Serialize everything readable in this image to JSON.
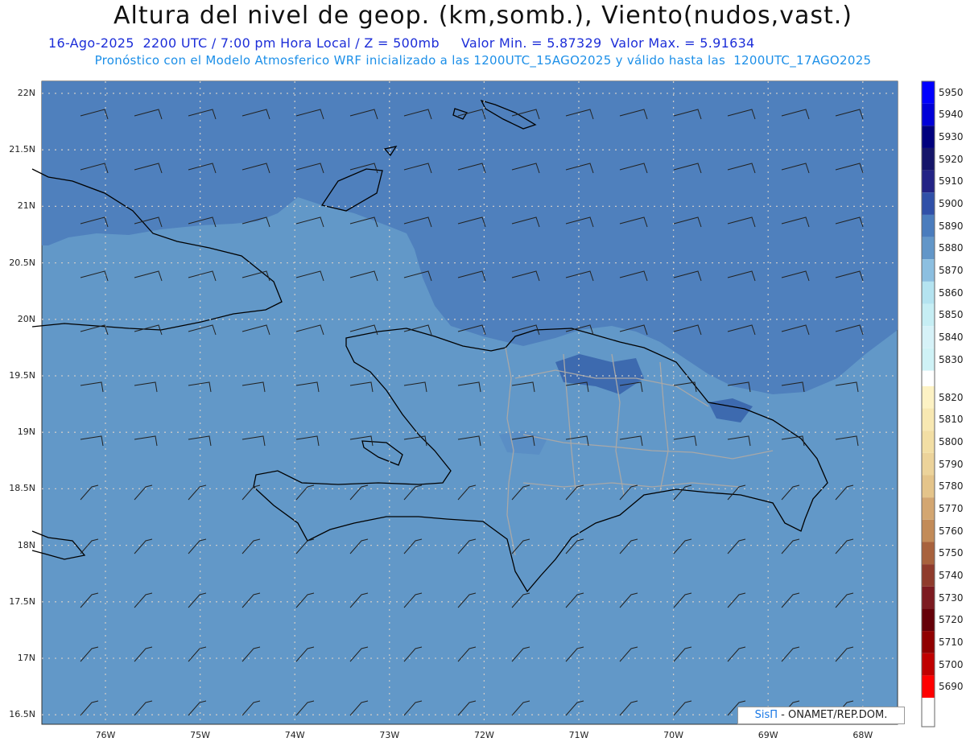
{
  "header": {
    "title": "Altura del nivel de geop. (km,somb.), Viento(nudos,vast.)",
    "subtitle1": "16-Ago-2025  2200 UTC / 7:00 pm Hora Local / Z = 500mb     Valor Min. = 5.87329  Valor Max. = 5.91634",
    "subtitle2": "Pronóstico con el Modelo Atmosferico WRF inicializado a las 1200UTC_15AGO2025 y válido hasta las  1200UTC_17AGO2025"
  },
  "axes": {
    "lat_labels": [
      "22N",
      "21.5N",
      "21N",
      "20.5N",
      "20N",
      "19.5N",
      "19N",
      "18.5N",
      "18N",
      "17.5N",
      "17N",
      "16.5N"
    ],
    "lon_labels": [
      "76W",
      "75W",
      "74W",
      "73W",
      "72W",
      "71W",
      "70W",
      "69W",
      "68W"
    ]
  },
  "colorbar": {
    "levels": [
      5950,
      5940,
      5930,
      5920,
      5910,
      5900,
      5890,
      5880,
      5870,
      5860,
      5850,
      5840,
      5830,
      5820,
      5810,
      5800,
      5790,
      5780,
      5770,
      5760,
      5750,
      5740,
      5730,
      5720,
      5710,
      5700,
      5690
    ],
    "colors": [
      "#0000ff",
      "#0000d8",
      "#00007e",
      "#151569",
      "#232385",
      "#3050a8",
      "#4a7cbd",
      "#6296c8",
      "#8cbfe0",
      "#b4e3f0",
      "#c6eef4",
      "#d6f2f8",
      "#cff2f6",
      "#fdf2c4",
      "#f8e8b2",
      "#f2dea4",
      "#ecd39a",
      "#e4c48a",
      "#d3a671",
      "#c28b58",
      "#a8623d",
      "#8f3b2c",
      "#7c1a20",
      "#650008",
      "#900000",
      "#c00000",
      "#ff0000"
    ]
  },
  "credit": {
    "brand": "SisΠ",
    "text": " - ONAMET/REP.DOM."
  }
}
